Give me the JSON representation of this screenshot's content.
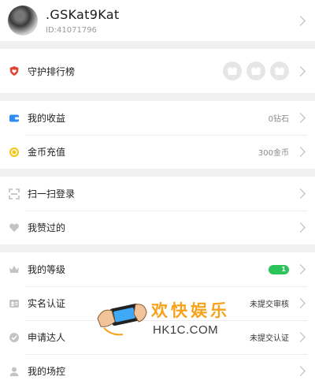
{
  "profile": {
    "name": ".GSKat9Kat",
    "id_label": "ID:41071796"
  },
  "guard": {
    "label": "守护排行榜"
  },
  "wallet": [
    {
      "label": "我的收益",
      "value": "0钻石"
    },
    {
      "label": "金币充值",
      "value": "300金币"
    }
  ],
  "actions": [
    {
      "label": "扫一扫登录"
    },
    {
      "label": "我赞过的"
    }
  ],
  "account": {
    "level": {
      "label": "我的等级",
      "badge": "1"
    },
    "realname": {
      "label": "实名认证",
      "value": "未提交审核"
    },
    "expert": {
      "label": "申请达人",
      "value": "未提交认证"
    },
    "control": {
      "label": "我的场控"
    }
  },
  "watermark": {
    "cn": "欢快娱乐",
    "en": "HK1C.COM"
  },
  "colors": {
    "level_badge": "#2bc45a",
    "guard_icon": "#e0463a",
    "wallet_icon": "#2f8cf0",
    "coin_icon": "#f5c518",
    "watermark": "#f6a21a"
  },
  "icons": [
    "shield-heart-icon",
    "wallet-icon",
    "coin-icon",
    "scan-icon",
    "heart-icon",
    "crown-icon",
    "id-card-icon",
    "verified-icon",
    "user-icon",
    "chevron-right-icon"
  ]
}
